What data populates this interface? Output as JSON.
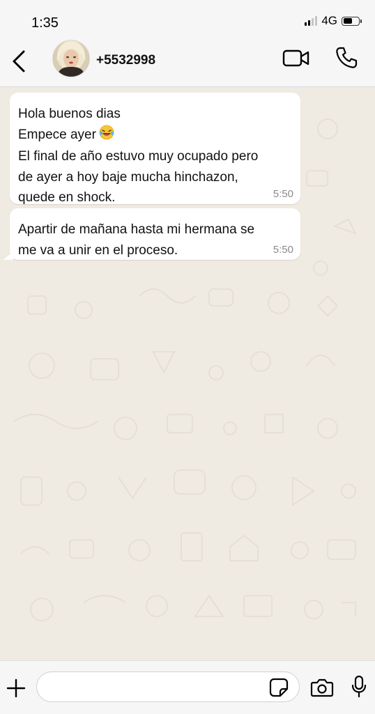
{
  "status_bar": {
    "time": "1:35",
    "network": "4G"
  },
  "header": {
    "contact_name": "+5532998",
    "icons": {
      "back": "chevron-left-icon",
      "video": "video-camera-icon",
      "call": "phone-icon"
    }
  },
  "messages": [
    {
      "text": "Hola buenos dias\nEmpece ayer",
      "emoji": "laughing-tears-emoji",
      "text_after": "El final de año estuvo muy ocupado pero de ayer a hoy baje mucha hinchazon, quede en shock.",
      "time": "5:50"
    },
    {
      "text": "Apartir de mañana hasta mi hermana se me va a unir en el proceso.",
      "time": "5:50"
    }
  ],
  "input_bar": {
    "placeholder": "",
    "icons": {
      "add": "plus-icon",
      "sticker": "sticker-icon",
      "camera": "camera-icon",
      "mic": "microphone-icon"
    }
  },
  "colors": {
    "chat_background": "#efeae2",
    "bubble": "#ffffff",
    "bar": "#f6f6f6"
  }
}
